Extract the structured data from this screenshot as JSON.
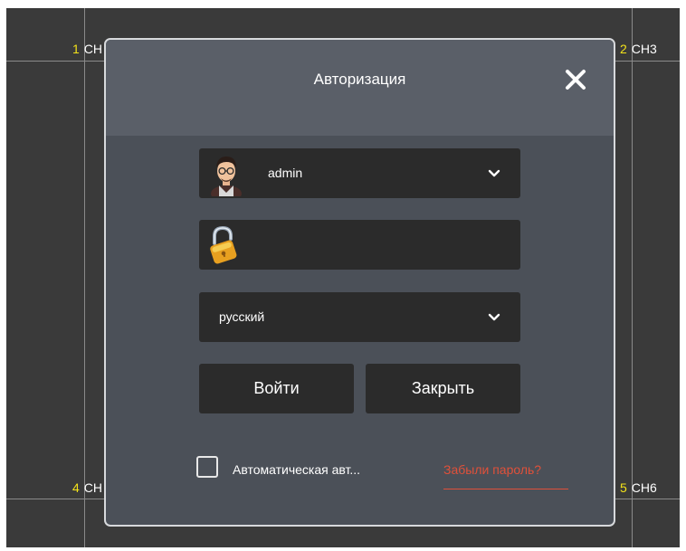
{
  "dialog": {
    "title": "Авторизация"
  },
  "channels": [
    {
      "num": "1",
      "name": "CH"
    },
    {
      "num": "2",
      "name": "CH3"
    },
    {
      "num": "4",
      "name": "CH"
    },
    {
      "num": "5",
      "name": "CH6"
    }
  ],
  "login": {
    "username": "admin",
    "password": "",
    "language": "русский",
    "login_label": "Войти",
    "close_label": "Закрыть",
    "auto_login_label": "Автоматическая авт...",
    "forgot_password_label": "Забыли пароль?"
  },
  "icons": {
    "close": "close-icon",
    "avatar": "user-avatar-icon",
    "lock": "lock-icon",
    "chevron": "chevron-down-icon"
  },
  "colors": {
    "accent_link": "#e0503a",
    "channel_number": "#f3e21a",
    "dialog_bg": "#4b5058",
    "field_bg": "#2b2b2b"
  }
}
